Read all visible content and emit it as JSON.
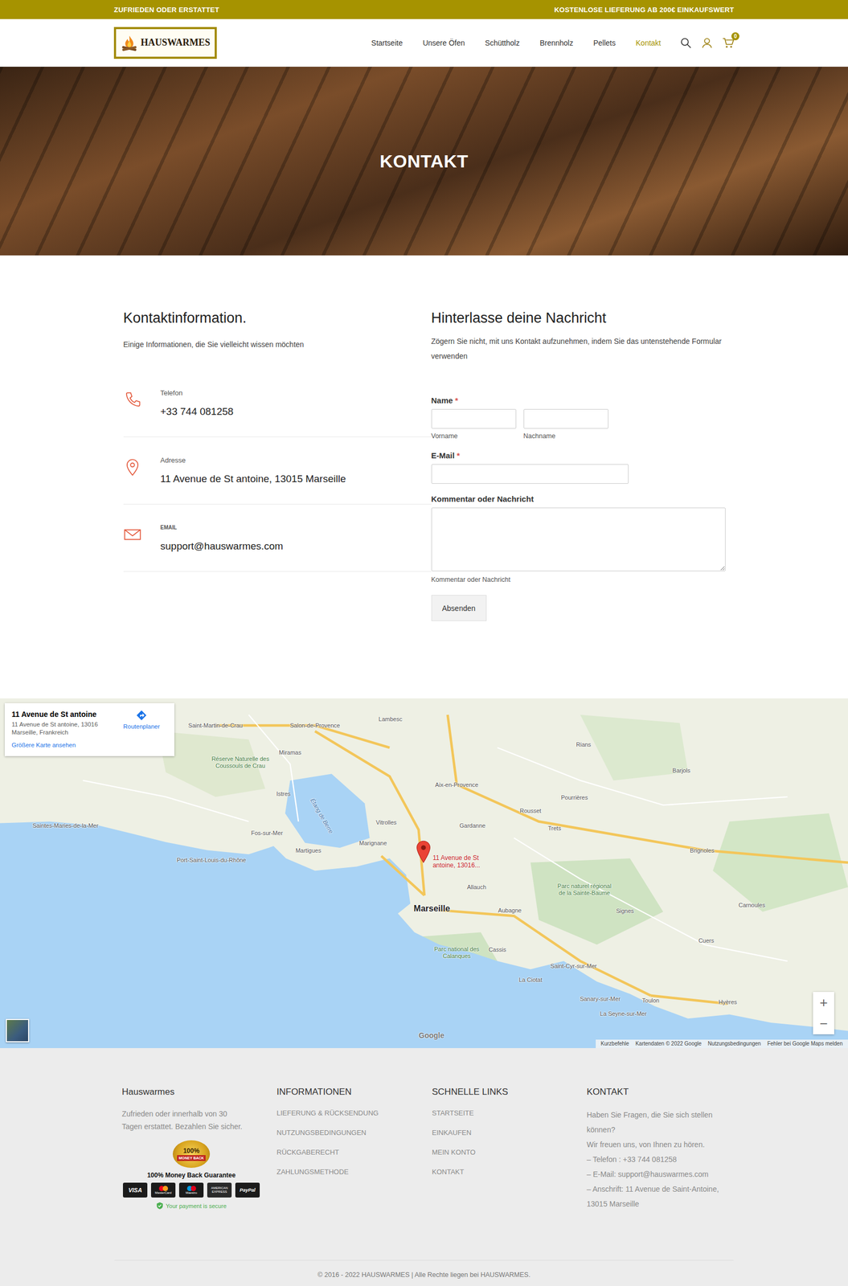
{
  "topbar": {
    "left": "ZUFRIEDEN ODER ERSTATTET",
    "right": "KOSTENLOSE LIEFERUNG AB 200€ EINKAUFSWERT"
  },
  "header": {
    "logo": "HAUSWARMES",
    "nav": [
      {
        "label": "Startseite",
        "selected": false
      },
      {
        "label": "Unsere Öfen",
        "selected": false
      },
      {
        "label": "Schüttholz",
        "selected": false
      },
      {
        "label": "Brennholz",
        "selected": false
      },
      {
        "label": "Pellets",
        "selected": false
      },
      {
        "label": "Kontakt",
        "selected": true
      }
    ],
    "cart_count": "0"
  },
  "hero": {
    "title": "KONTAKT"
  },
  "contact_info": {
    "title": "Kontaktinformation.",
    "subtitle": "Einige Informationen, die Sie vielleicht wissen möchten",
    "rows": [
      {
        "kind": "phone",
        "label": "Telefon",
        "value": "+33 744 081258"
      },
      {
        "kind": "address",
        "label": "Adresse",
        "value": "11 Avenue de St antoine, 13015 Marseille"
      },
      {
        "kind": "email",
        "label": "EMAIL",
        "value": "support@hauswarmes.com"
      }
    ]
  },
  "form": {
    "title": "Hinterlasse deine Nachricht",
    "intro": "Zögern Sie nicht, mit uns Kontakt aufzunehmen, indem Sie das untenstehende Formular verwenden",
    "name_label": "Name",
    "required_mark": "*",
    "first_hint": "Vorname",
    "last_hint": "Nachname",
    "email_label": "E-Mail",
    "message_label": "Kommentar oder Nachricht",
    "message_hint": "Kommentar oder Nachricht",
    "submit": "Absenden"
  },
  "map": {
    "card": {
      "title": "11 Avenue de St antoine",
      "address": "11 Avenue de St antoine, 13016 Marseille, Frankreich",
      "directions": "Routenplaner",
      "larger": "Größere Karte ansehen"
    },
    "marker_label": "11 Avenue de St antoine, 13016...",
    "places": [
      {
        "name": "Marseille",
        "kind": "city"
      },
      {
        "name": "Aix-en-Provence",
        "kind": "town"
      },
      {
        "name": "Toulon",
        "kind": "town"
      },
      {
        "name": "Salon-de-Provence",
        "kind": "town"
      },
      {
        "name": "Saint-Martin-de-Crau",
        "kind": "town"
      },
      {
        "name": "Lambesc",
        "kind": "town"
      },
      {
        "name": "Miramas",
        "kind": "town"
      },
      {
        "name": "Istres",
        "kind": "town"
      },
      {
        "name": "Saintes-Maries-de-la-Mer",
        "kind": "town"
      },
      {
        "name": "Port-Saint-Louis-du-Rhône",
        "kind": "town"
      },
      {
        "name": "Fos-sur-Mer",
        "kind": "town"
      },
      {
        "name": "Martigues",
        "kind": "town"
      },
      {
        "name": "Marignane",
        "kind": "town"
      },
      {
        "name": "Vitrolles",
        "kind": "town"
      },
      {
        "name": "Gardanne",
        "kind": "town"
      },
      {
        "name": "Rousset",
        "kind": "town"
      },
      {
        "name": "Trets",
        "kind": "town"
      },
      {
        "name": "Pourrières",
        "kind": "town"
      },
      {
        "name": "Rians",
        "kind": "town"
      },
      {
        "name": "Barjols",
        "kind": "town"
      },
      {
        "name": "Brignoles",
        "kind": "town"
      },
      {
        "name": "Allauch",
        "kind": "town"
      },
      {
        "name": "Aubagne",
        "kind": "town"
      },
      {
        "name": "Cassis",
        "kind": "town"
      },
      {
        "name": "La Ciotat",
        "kind": "town"
      },
      {
        "name": "Saint-Cyr-sur-Mer",
        "kind": "town"
      },
      {
        "name": "Signes",
        "kind": "town"
      },
      {
        "name": "Cuers",
        "kind": "town"
      },
      {
        "name": "Carnoules",
        "kind": "town"
      },
      {
        "name": "Sanary-sur-Mer",
        "kind": "town"
      },
      {
        "name": "La Seyne-sur-Mer",
        "kind": "town"
      },
      {
        "name": "Hyères",
        "kind": "town"
      },
      {
        "name": "Étang de Berre",
        "kind": "water"
      },
      {
        "name": "Parc national des Calanques",
        "kind": "park"
      },
      {
        "name": "Parc naturel régional de la Sainte-Baume",
        "kind": "park"
      },
      {
        "name": "Réserve Naturelle des Coussouls de Crau",
        "kind": "park"
      }
    ],
    "logo": "Google",
    "zoom_in": "+",
    "zoom_out": "−",
    "attribution": [
      "Kurzbefehle",
      "Kartendaten © 2022 Google",
      "Nutzungsbedingungen",
      "Fehler bei Google Maps melden"
    ]
  },
  "footer": {
    "about": {
      "title": "Hauswarmes",
      "text": "Zufrieden oder innerhalb von 30 Tagen erstattet. Bezahlen Sie sicher.",
      "medal_top": "100%",
      "medal_band": "MONEY BACK",
      "guarantee": "100% Money Back Guarantee",
      "cards": [
        {
          "kind": "visa",
          "label": "VISA"
        },
        {
          "kind": "mastercard",
          "label": "MasterCard"
        },
        {
          "kind": "maestro",
          "label": "Maestro"
        },
        {
          "kind": "amex",
          "label": "AMERICAN EXPRESS"
        },
        {
          "kind": "paypal",
          "label": "PayPal"
        }
      ],
      "secure": "Your payment is secure"
    },
    "columns": [
      {
        "title": "INFORMATIONEN",
        "links": [
          "LIEFERUNG & RÜCKSENDUNG",
          "NUTZUNGSBEDINGUNGEN",
          "RÜCKGABERECHT",
          "ZAHLUNGSMETHODE"
        ]
      },
      {
        "title": "SCHNELLE LINKS",
        "links": [
          "STARTSEITE",
          "EINKAUFEN",
          "MEIN KONTO",
          "KONTAKT"
        ]
      }
    ],
    "contact": {
      "title": "KONTAKT",
      "lines": [
        "Haben Sie Fragen, die Sie sich stellen können?",
        "Wir freuen uns, von Ihnen zu hören.",
        "– Telefon : +33 744 081258",
        "– E-Mail: support@hauswarmes.com",
        "– Anschrift: 11 Avenue de Saint-Antoine, 13015 Marseille"
      ]
    },
    "copyright": "© 2016 - 2022 HAUSWARMES | Alle Rechte liegen bei HAUSWARMES."
  }
}
